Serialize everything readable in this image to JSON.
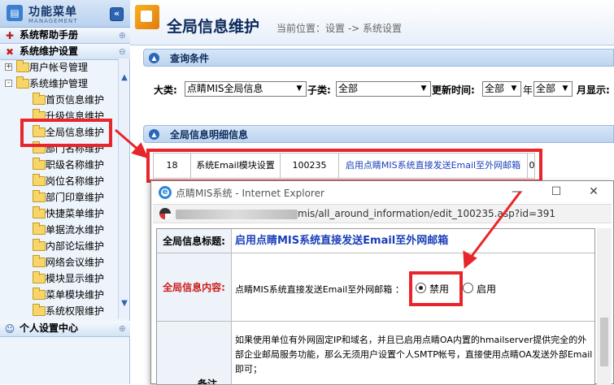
{
  "sidebar": {
    "title": "功能菜单",
    "subtitle": "MANAGEMENT",
    "collapse_glyph": "«",
    "sections": [
      {
        "label": "系统帮助手册",
        "icon": "help-book-icon"
      },
      {
        "label": "系统维护设置",
        "icon": "tools-icon"
      },
      {
        "label": "个人设置中心",
        "icon": "users-icon"
      }
    ],
    "tree": [
      {
        "label": "用户帐号管理",
        "toggle": "+"
      },
      {
        "label": "系统维护管理",
        "toggle": "-"
      },
      {
        "label": "首页信息维护"
      },
      {
        "label": "升级信息维护"
      },
      {
        "label": "全局信息维护"
      },
      {
        "label": "部门名称维护"
      },
      {
        "label": "职级名称维护"
      },
      {
        "label": "岗位名称维护"
      },
      {
        "label": "部门印章维护"
      },
      {
        "label": "快捷菜单维护"
      },
      {
        "label": "单据流水维护"
      },
      {
        "label": "内部论坛维护"
      },
      {
        "label": "网络会议维护"
      },
      {
        "label": "模块显示维护"
      },
      {
        "label": "菜单模块维护"
      },
      {
        "label": "系统权限维护"
      }
    ]
  },
  "header": {
    "title": "全局信息维护",
    "breadcrumb": "当前位置：设置 -> 系统设置"
  },
  "query_panel": {
    "title": "查询条件",
    "fields": [
      {
        "label": "大类:",
        "value": "点睛MIS全局信息"
      },
      {
        "label": "子类:",
        "value": "全部"
      },
      {
        "label": "更新时间:",
        "value": "全部"
      },
      {
        "label": "年",
        "value": "全部"
      },
      {
        "label": "月显示:",
        "value": ""
      }
    ]
  },
  "detail_panel": {
    "title": "全局信息明细信息",
    "row": {
      "id": "18",
      "category": "系统Email模块设置",
      "code": "100235",
      "link": "启用点睛MIS系统直接发送Email至外网邮箱",
      "value": "0"
    }
  },
  "popup": {
    "window_title": "点睛MIS系统 - Internet Explorer",
    "url": "mis/all_around_information/edit_100235.asp?id=391",
    "title_label": "全局信息标题:",
    "title_value": "启用点睛MIS系统直接发送Email至外网邮箱",
    "content_label": "全局信息内容:",
    "content_prompt": "点睛MIS系统直接发送Email至外网邮箱 ：",
    "radio_disable": "禁用",
    "radio_enable": "启用",
    "note": "如果使用单位有外网固定IP和域名，并且已启用点睛OA内置的hmailserver提供完全的外部企业邮局服务功能，那么无须用户设置个人SMTP帐号，直接使用点睛OA发送外部Email即可；",
    "note_label": "备注"
  },
  "colors": {
    "highlight_red": "#e8252b",
    "link_blue": "#1a3fb8",
    "title_blue": "#0c2a5c"
  }
}
